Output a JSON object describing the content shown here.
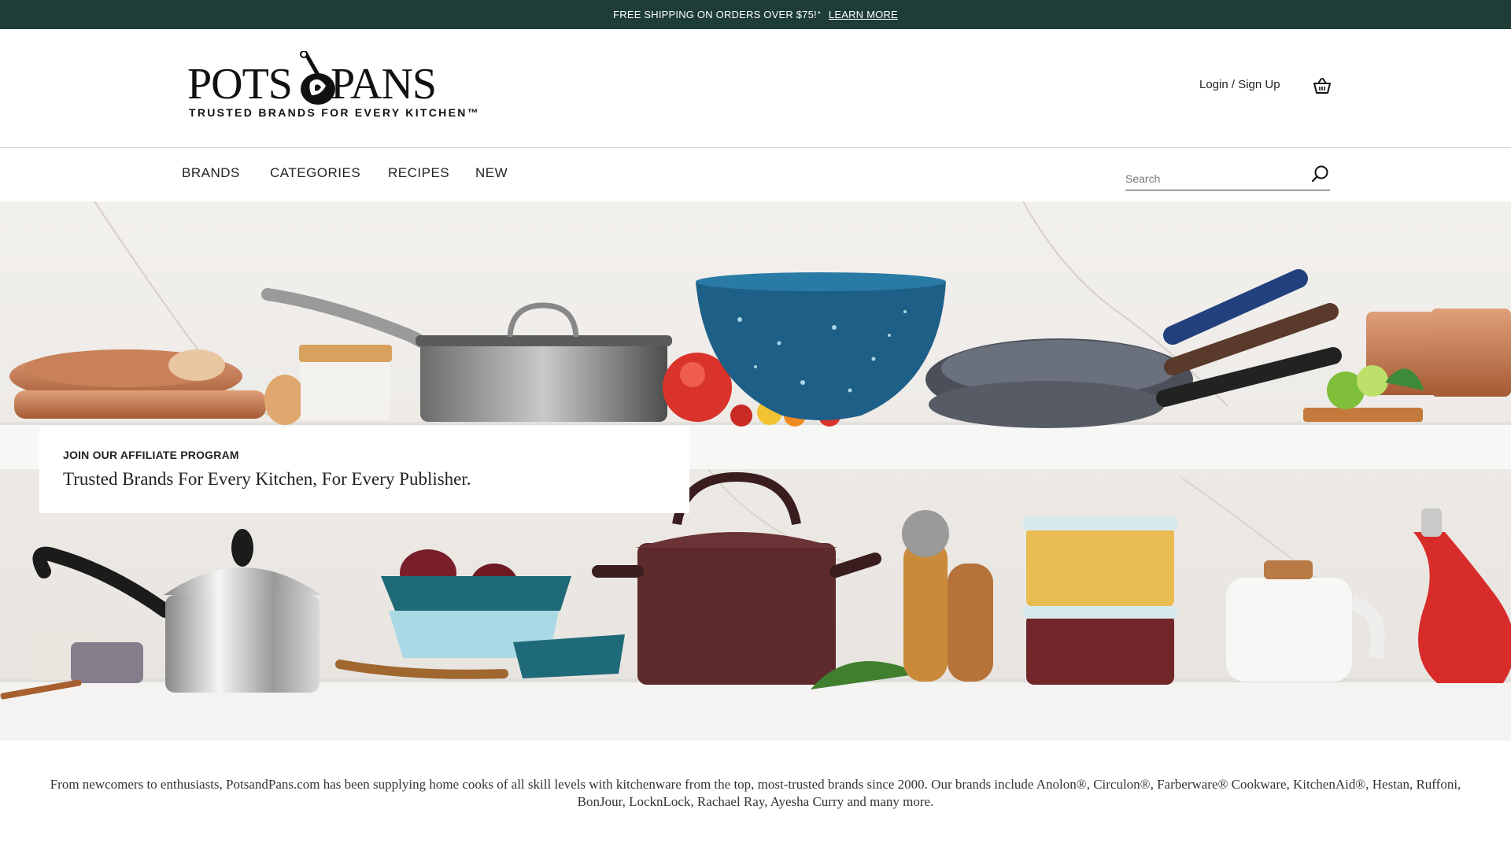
{
  "promo": {
    "text": "FREE SHIPPING ON ORDERS OVER $75!",
    "mark": "*",
    "link": "LEARN MORE"
  },
  "header": {
    "logo_word1": "POTS",
    "logo_word2": "PANS",
    "logo_tagline": "TRUSTED BRANDS FOR EVERY KITCHEN™",
    "login": "Login / Sign Up",
    "cart_icon": "basket-icon"
  },
  "nav": {
    "items": [
      "BRANDS",
      "CATEGORIES",
      "RECIPES",
      "NEW"
    ],
    "search_placeholder": "Search",
    "search_icon": "search-icon"
  },
  "hero": {
    "eyebrow": "JOIN OUR AFFILIATE PROGRAM",
    "headline": "Trusted Brands For Every Kitchen, For Every Publisher."
  },
  "about": {
    "text": "From newcomers to enthusiasts, PotsandPans.com has been supplying home cooks of all skill levels with kitchenware from the top, most-trusted brands since 2000. Our brands include Anolon®, Circulon®, Farberware® Cookware, KitchenAid®, Hestan, Ruffoni, BonJour, LocknLock, Rachael Ray, Ayesha Curry and many more."
  },
  "colors": {
    "promo_bg": "#1d3d36",
    "text": "#222222",
    "divider": "#d7d7d7"
  }
}
